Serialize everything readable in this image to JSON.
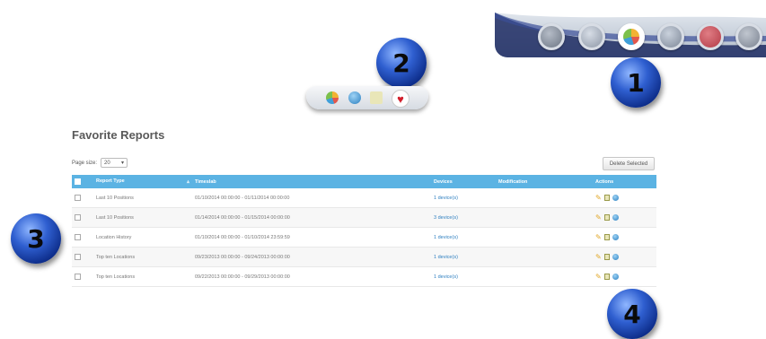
{
  "toolbar": {
    "icons": [
      "gray-circle-icon",
      "map-icon",
      "pie-chart-icon",
      "home-icon",
      "help-icon",
      "gray-circle-icon"
    ]
  },
  "mini_toolbar": {
    "icons": [
      "pie-chart-icon",
      "globe-icon",
      "schedule-icon",
      "heart-icon"
    ],
    "heart_glyph": "♥"
  },
  "callouts": [
    "1",
    "2",
    "3",
    "4"
  ],
  "main": {
    "title": "Favorite Reports",
    "page_size_label": "Page size:",
    "page_size_value": "20",
    "page_size_caret": "▾",
    "delete_button": "Delete Selected",
    "table": {
      "columns": [
        "Report Type",
        "Timeslab",
        "Devices",
        "Modification",
        "Actions"
      ],
      "sort_glyph": "▴",
      "rows": [
        {
          "type": "Last 10 Positions",
          "timeslab": "01/10/2014 00:00:00 - 01/11/2014 00:00:00",
          "devices": "1 device(s)"
        },
        {
          "type": "Last 10 Positions",
          "timeslab": "01/14/2014 00:00:00 - 01/15/2014 00:00:00",
          "devices": "3 device(s)"
        },
        {
          "type": "Location History",
          "timeslab": "01/10/2014 00:00:00 - 01/10/2014 23:59:59",
          "devices": "1 device(s)"
        },
        {
          "type": "Top ten Locations",
          "timeslab": "09/23/2013 00:00:00 - 09/24/2013 00:00:00",
          "devices": "1 device(s)"
        },
        {
          "type": "Top ten Locations",
          "timeslab": "09/22/2013 00:00:00 - 09/29/2013 00:00:00",
          "devices": "1 device(s)"
        }
      ],
      "edit_glyph": "✎"
    }
  },
  "colors": {
    "header_blue": "#5bb3e3",
    "link_blue": "#2e7fc0",
    "callout_blue": "#2f5fd0",
    "heart_red": "#d21f2b"
  }
}
